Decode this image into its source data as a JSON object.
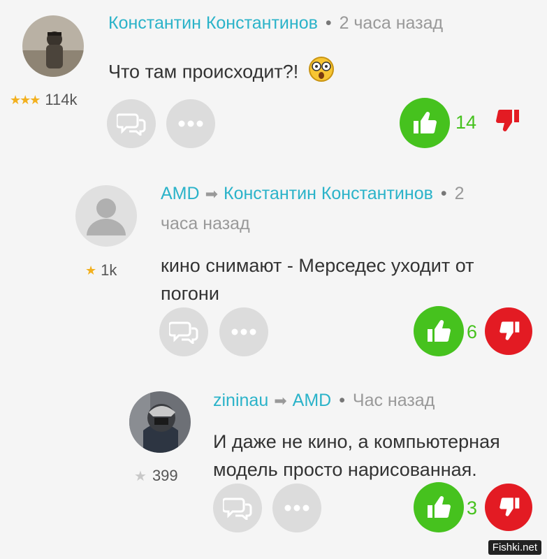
{
  "comments": [
    {
      "author": "Константин Константинов",
      "time": "2 часа назад",
      "text": "Что там происходит?!",
      "rating": "114k",
      "likes": "14",
      "emoji": "shocked-emoji"
    },
    {
      "author": "AMD",
      "reply_to": "Константин Константинов",
      "time_part1": "2",
      "time_part2": "часа назад",
      "text_line1": "кино снимают - Мерседес уходит от",
      "text_line2": "погони",
      "rating": "1k",
      "likes": "6"
    },
    {
      "author": "zininau",
      "reply_to": "AMD",
      "time": "Час назад",
      "text_line1": "И даже не кино, а компьютерная",
      "text_line2": "модель просто нарисованная.",
      "rating": "399",
      "likes": "3"
    }
  ],
  "colors": {
    "author": "#2bb3c9",
    "like": "#46c21e",
    "dislike": "#e31b23",
    "button_gray": "#dcdcdc"
  },
  "icons": {
    "reply": "speech-bubbles-icon",
    "more": "ellipsis-icon",
    "like": "thumbs-up-icon",
    "dislike": "thumbs-down-icon"
  },
  "watermark": "Fishki.net"
}
